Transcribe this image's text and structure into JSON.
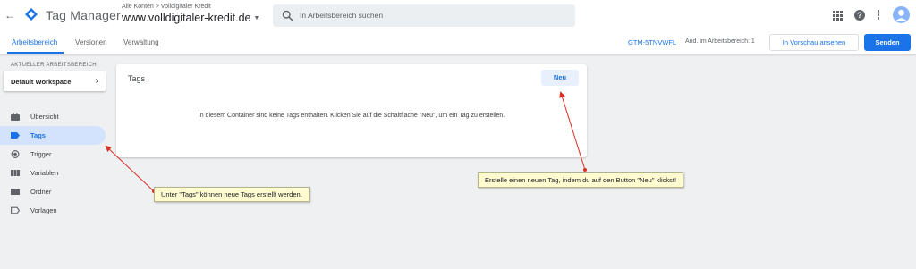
{
  "header": {
    "back_icon": "back-arrow-icon",
    "app_title": "Tag Manager",
    "breadcrumb": "Alle Konten > Volldigitaler Kredit",
    "container_name": "www.volldigitaler-kredit.de",
    "search_placeholder": "In Arbeitsbereich suchen"
  },
  "subnav": {
    "tabs": [
      {
        "label": "Arbeitsbereich",
        "active": true
      },
      {
        "label": "Versionen",
        "active": false
      },
      {
        "label": "Verwaltung",
        "active": false
      }
    ],
    "container_id": "GTM-5TNVWFL",
    "workspace_changes": "Änd. im Arbeitsbereich: 1",
    "preview_label": "In Vorschau ansehen",
    "send_label": "Senden"
  },
  "sidebar": {
    "workspace_label": "AKTUELLER ARBEITSBEREICH",
    "workspace_name": "Default Workspace",
    "items": [
      {
        "label": "Übersicht",
        "icon": "briefcase-icon",
        "active": false
      },
      {
        "label": "Tags",
        "icon": "tag-icon",
        "active": true
      },
      {
        "label": "Trigger",
        "icon": "trigger-icon",
        "active": false
      },
      {
        "label": "Variablen",
        "icon": "variables-icon",
        "active": false
      },
      {
        "label": "Ordner",
        "icon": "folder-icon",
        "active": false
      },
      {
        "label": "Vorlagen",
        "icon": "template-icon",
        "active": false
      }
    ]
  },
  "main": {
    "card_title": "Tags",
    "new_button": "Neu",
    "empty_message": "In diesem Container sind keine Tags enthalten. Klicken Sie auf die Schaltfläche \"Neu\", um ein Tag zu erstellen."
  },
  "annotations": {
    "sidebar_note": "Unter \"Tags\" können neue Tags erstellt werden.",
    "new_button_note": "Erstelle einen neuen Tag, indem du auf den Button \"Neu\" klickst!"
  },
  "colors": {
    "accent": "#1a73e8",
    "annotation_arrow": "#d93025",
    "annotation_bg": "#fefbd0"
  }
}
